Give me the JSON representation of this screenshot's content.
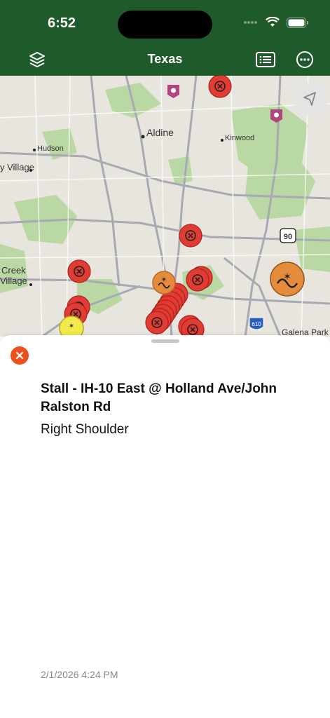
{
  "status": {
    "time": "6:52"
  },
  "nav": {
    "title": "Texas"
  },
  "map": {
    "places": [
      "Aldine",
      "Kinwood",
      "Hudson",
      "y Village",
      "Creek",
      "Village",
      "Galena Park"
    ],
    "shields": [
      "90",
      "610"
    ]
  },
  "incident": {
    "title": "Stall - IH-10 East @ Holland Ave/John Ralston Rd",
    "subtitle": "Right Shoulder",
    "timestamp": "2/1/2026 4:24 PM"
  },
  "colors": {
    "brand": "#1e5a2a",
    "close": "#ef4f1a",
    "closure": "#e23b34",
    "crash": "#e58c3c",
    "caution": "#f2ea4a"
  },
  "icons": [
    "layers-icon",
    "list-icon",
    "more-icon",
    "locate-icon",
    "close-icon",
    "closure-marker-icon",
    "crash-marker-icon"
  ]
}
